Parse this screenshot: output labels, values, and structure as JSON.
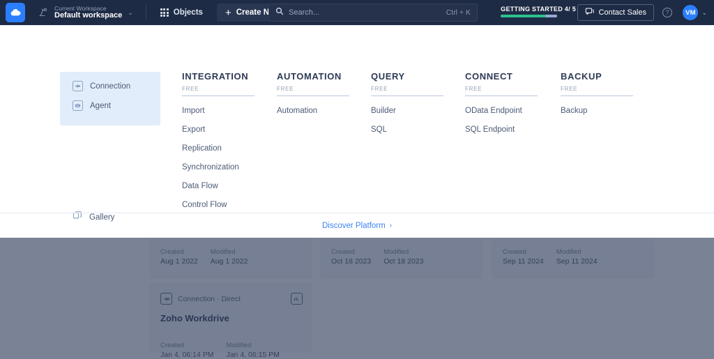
{
  "navbar": {
    "logo_icon": "cloud-logo-icon",
    "workspace": {
      "label": "Current Workspace",
      "value": "Default workspace",
      "icon": "workspace-icon",
      "caret": "⌄"
    },
    "objects_label": "Objects",
    "create_new_label": "Create New",
    "create_new_plus": "+",
    "search": {
      "placeholder": "Search...",
      "value": "",
      "shortcut": "Ctrl + K",
      "icon": "search-icon"
    },
    "getting_started": {
      "label": "GETTING STARTED 4/ 5",
      "progress_percent": 80,
      "fill_color": "#2dc08d",
      "track_color": "#9aa8d8"
    },
    "contact_sales_label": "Contact Sales",
    "help_label": "?",
    "avatar_initials": "VM",
    "avatar_caret": "⌄",
    "avatar_color": "#2b7fff",
    "background_color": "#1e2b45"
  },
  "mega_menu": {
    "left_panel": {
      "items": [
        {
          "label": "Connection",
          "icon": "connection-icon"
        },
        {
          "label": "Agent",
          "icon": "agent-icon"
        }
      ],
      "background_color": "#e2edfb"
    },
    "gallery": {
      "label": "Gallery",
      "icon": "gallery-icon"
    },
    "columns": [
      {
        "title": "INTEGRATION",
        "tier": "FREE",
        "links": [
          "Import",
          "Export",
          "Replication",
          "Synchronization",
          "Data Flow",
          "Control Flow"
        ]
      },
      {
        "title": "AUTOMATION",
        "tier": "FREE",
        "links": [
          "Automation"
        ]
      },
      {
        "title": "QUERY",
        "tier": "FREE",
        "links": [
          "Builder",
          "SQL"
        ]
      },
      {
        "title": "CONNECT",
        "tier": "FREE",
        "links": [
          "OData Endpoint",
          "SQL Endpoint"
        ]
      },
      {
        "title": "BACKUP",
        "tier": "FREE",
        "links": [
          "Backup"
        ]
      }
    ],
    "discover": {
      "label": "Discover Platform",
      "caret": "›",
      "color": "#3c82f6"
    }
  },
  "background_cards": [
    {
      "created_label": "Created",
      "created_value": "Aug 1 2022",
      "modified_label": "Modified",
      "modified_value": "Aug 1 2022"
    },
    {
      "created_label": "Created",
      "created_value": "Oct 18 2023",
      "modified_label": "Modified",
      "modified_value": "Oct 18 2023"
    },
    {
      "created_label": "Created",
      "created_value": "Sep 11 2024",
      "modified_label": "Modified",
      "modified_value": "Sep 11 2024"
    }
  ],
  "focused_card": {
    "type": "Connection · Direct",
    "type_icon": "connection-icon",
    "title": "Zoho Workdrive",
    "action_icon": "chart-icon",
    "created_label": "Created",
    "created_value": "Jan 4, 06:14 PM",
    "modified_label": "Modified",
    "modified_value": "Jan 4, 06:15 PM"
  }
}
